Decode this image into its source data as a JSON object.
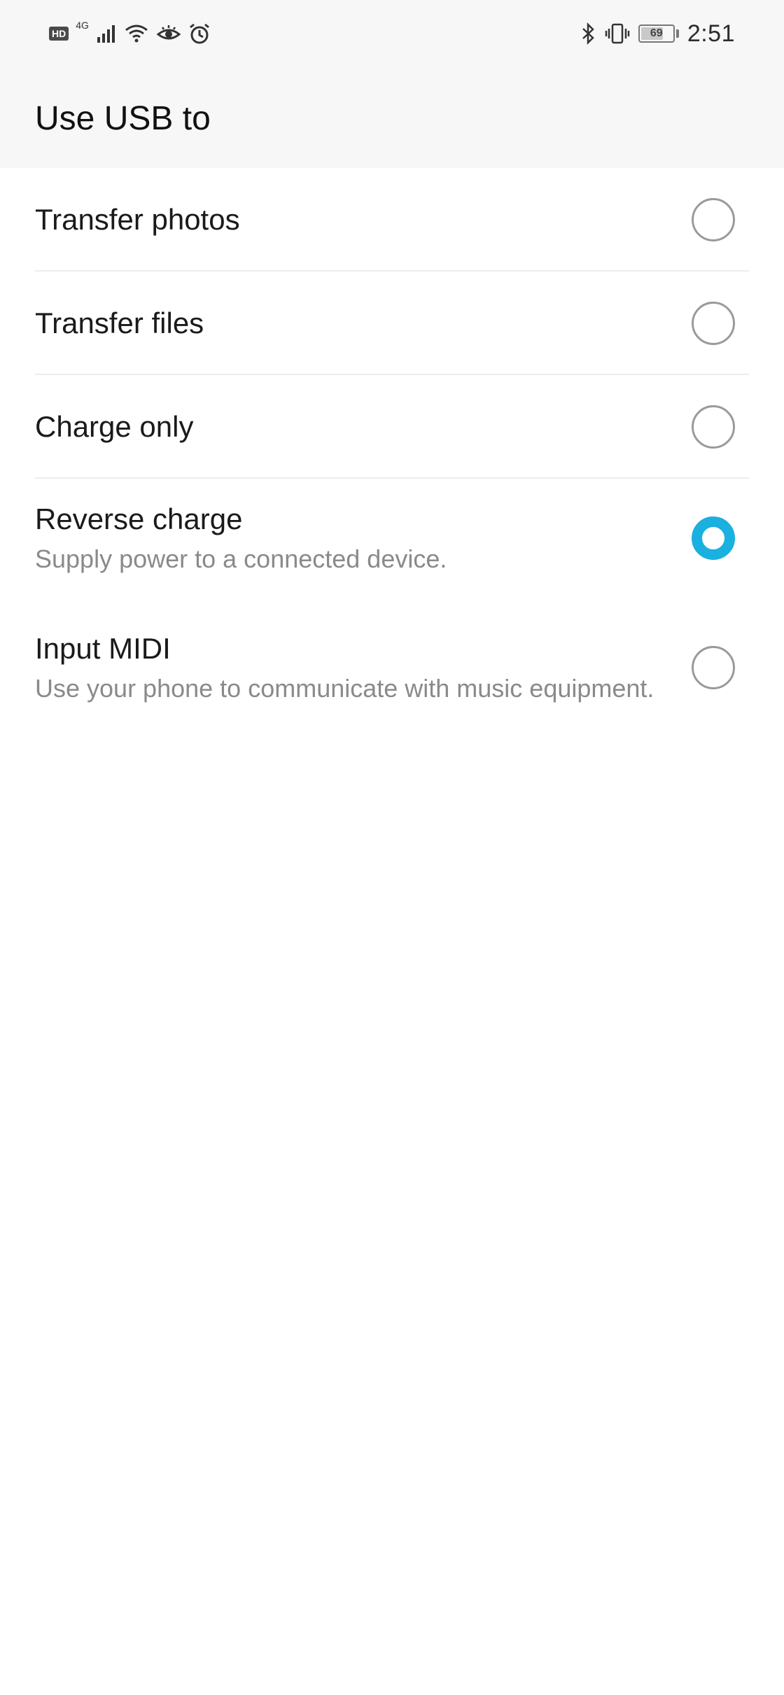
{
  "status_bar": {
    "left_icons": [
      {
        "name": "hd-icon",
        "text": "HD"
      },
      {
        "name": "network-type-icon",
        "text": "4G"
      },
      {
        "name": "signal-icon"
      },
      {
        "name": "wifi-icon"
      },
      {
        "name": "eye-icon"
      },
      {
        "name": "alarm-icon"
      }
    ],
    "right_icons": [
      {
        "name": "bluetooth-icon"
      },
      {
        "name": "vibrate-icon"
      }
    ],
    "battery_level": "69",
    "time": "2:51"
  },
  "page": {
    "title": "Use USB to"
  },
  "options": [
    {
      "label": "Transfer photos",
      "description": "",
      "selected": false
    },
    {
      "label": "Transfer files",
      "description": "",
      "selected": false
    },
    {
      "label": "Charge only",
      "description": "",
      "selected": false
    },
    {
      "label": "Reverse charge",
      "description": "Supply power to a connected device.",
      "selected": true
    },
    {
      "label": "Input MIDI",
      "description": "Use your phone to communicate with music equipment.",
      "selected": false
    }
  ],
  "colors": {
    "accent": "#1ab0e0",
    "header_background": "#f7f7f7",
    "description_text": "#8a8a8a"
  }
}
